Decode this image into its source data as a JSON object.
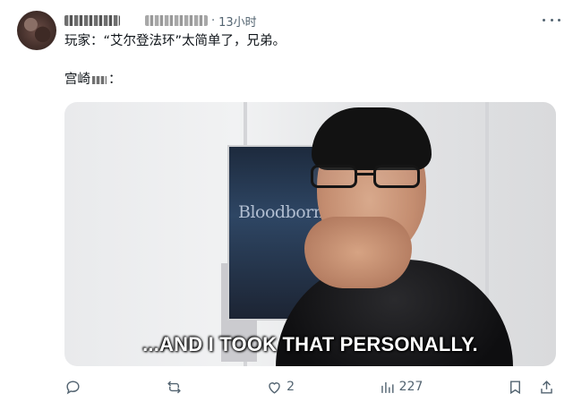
{
  "tweet": {
    "time": "13小时",
    "text_line1": "玩家：“艾尔登法环”太简单了，兄弟。",
    "text_line2_prefix": "宫崎",
    "text_line2_suffix": "：",
    "media": {
      "poster_title": "Bloodborne",
      "caption": "...AND I TOOK THAT PERSONALLY."
    },
    "actions": {
      "likes": "2",
      "views": "227"
    }
  }
}
